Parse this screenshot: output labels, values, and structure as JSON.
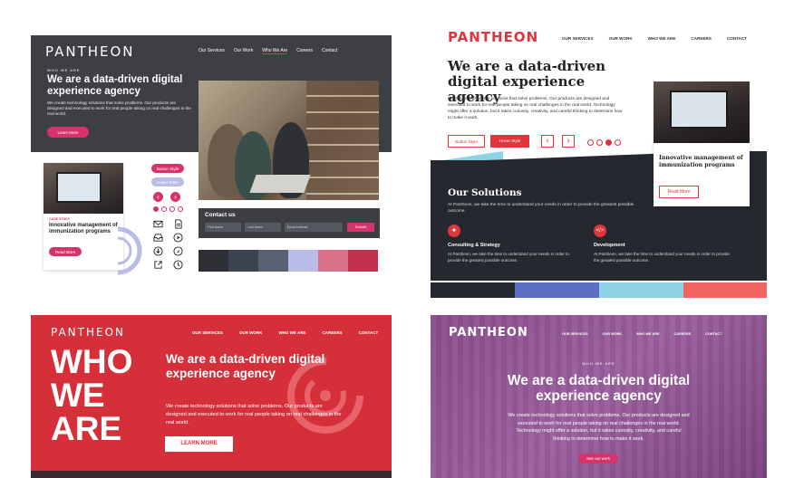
{
  "brand": {
    "name": "PANTHEON",
    "red": "#e0353d",
    "pink": "#d6336c",
    "dark": "#3d3f45",
    "purple": "#8e4f91"
  },
  "panel1": {
    "nav": [
      "Our Services",
      "Our Work",
      "Who We Are",
      "Careers",
      "Contact"
    ],
    "eyebrow": "WHO WE ARE",
    "headline": "We are a data-driven digital experience agency",
    "body": "We create technology solutions that solve problems. Our products are designed and executed to work for real people taking on real challenges in the real world.",
    "cta": "Learn More",
    "button_style": "Button Style",
    "hover_style": "Hover State",
    "card": {
      "tag": "CASE STUDY",
      "title": "Innovative management of immunization programs",
      "cta": "Read More"
    },
    "contact": {
      "title": "Contact us",
      "fields": [
        "First Name",
        "Last Name",
        "Email Address"
      ],
      "submit": "Submit"
    },
    "swatches": [
      "#2d2f35",
      "#3d4250",
      "#586274",
      "#b9bce6",
      "#d9708a",
      "#c43050"
    ],
    "icons": [
      "mail-icon",
      "document-icon",
      "inbox-icon",
      "play-icon",
      "download-icon",
      "navigation-icon",
      "external-link-icon",
      "clock-icon"
    ]
  },
  "panel2": {
    "nav": [
      "OUR SERVICES",
      "OUR WORK",
      "WHO WE ARE",
      "CAREERS",
      "CONTACT"
    ],
    "headline": "We are a data-driven digital experience agency",
    "body": "We create technology solutions that solve problems. Our products are designed and executed to work for real people taking on real challenges in the real world. Technology might offer a solution, but it takes curiosity, creativity, and careful thinking to determine how to make it work.",
    "button_style": "Button Style",
    "hover_style": "Hover Style",
    "card": {
      "title": "Innovative management of immunization programs",
      "cta": "Read More"
    },
    "solutions_title": "Our Solutions",
    "solutions_body": "At Pantheon, we take the time to understand your needs in order to provide the greatest possible outcome.",
    "services": [
      {
        "title": "Consulting & Strategy",
        "body": "At Pantheon, we take the time to understand your needs in order to provide the greatest possible outcome."
      },
      {
        "title": "Development",
        "body": "At Pantheon, we take the time to understand your needs in order to provide the greatest possible outcome."
      }
    ],
    "stripes": [
      "#262830",
      "#5a6fc4",
      "#8fd3e6",
      "#f06462"
    ]
  },
  "panel3": {
    "nav": [
      "OUR SERVICES",
      "OUR WORK",
      "WHO WE ARE",
      "CAREERS",
      "CONTACT"
    ],
    "big": [
      "WHO",
      "WE",
      "ARE"
    ],
    "headline": "We are a data-driven digital experience agency",
    "body": "We create technology solutions that solve problems. Our products are designed and executed to work for real people taking on real challenges in the real world.",
    "cta": "LEARN MORE"
  },
  "panel4": {
    "nav": [
      "OUR SERVICES",
      "OUR WORK",
      "WHO WE ARE",
      "CAREERS",
      "CONTACT"
    ],
    "eyebrow": "WHO WE ARE",
    "headline": "We are a data-driven digital experience agency",
    "body": "We create technology solutions that solve problems. Our products are designed and executed to work for real people taking on real challenges in the real world. Technology might offer a solution, but it takes curiosity, creativity, and careful thinking to determine how to make it work.",
    "cta": "See our work"
  }
}
